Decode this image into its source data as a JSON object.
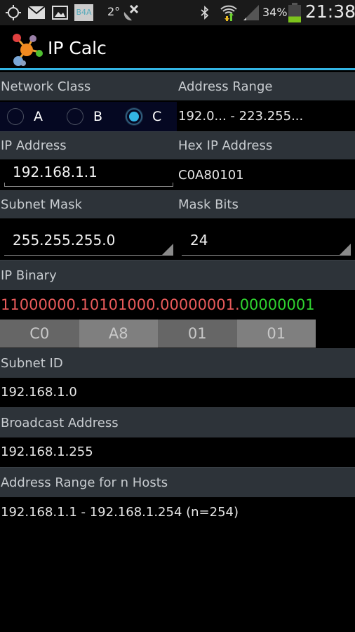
{
  "status_bar": {
    "icons_left": [
      "gps-icon",
      "email-icon",
      "gallery-icon",
      "b4a-icon",
      "weather-icon",
      "satellite-off-icon"
    ],
    "b4a_label": "B4A",
    "temperature": "2°",
    "icons_right": [
      "bluetooth-icon",
      "wifi-icon",
      "signal-icon",
      "battery-icon"
    ],
    "battery": "34%",
    "battery_level": 0.34,
    "time": "21:38"
  },
  "app": {
    "title": "IP Calc",
    "accent_color": "#33b5e5"
  },
  "network_class": {
    "label": "Network Class",
    "options": [
      {
        "label": "A",
        "checked": false
      },
      {
        "label": "B",
        "checked": false
      },
      {
        "label": "C",
        "checked": true
      }
    ]
  },
  "address_range": {
    "label": "Address Range",
    "value": "192.0... - 223.255..."
  },
  "ip_address": {
    "label": "IP Address",
    "value": "192.168.1.1"
  },
  "hex_ip": {
    "label": "Hex IP Address",
    "value": "C0A80101"
  },
  "subnet_mask": {
    "label": "Subnet Mask",
    "value": "255.255.255.0"
  },
  "mask_bits": {
    "label": "Mask Bits",
    "value": "24"
  },
  "ip_binary": {
    "label": "IP Binary",
    "network_part": "11000000.10101000.00000001.",
    "host_part": "00000001",
    "network_color": "#e85a5a",
    "host_color": "#2fd22f",
    "hex_octets": [
      {
        "value": "C0",
        "color": "#666666"
      },
      {
        "value": "A8",
        "color": "#7f7f7f"
      },
      {
        "value": "01",
        "color": "#666666"
      },
      {
        "value": "01",
        "color": "#7f7f7f"
      }
    ]
  },
  "subnet_id": {
    "label": "Subnet ID",
    "value": "192.168.1.0"
  },
  "broadcast": {
    "label": "Broadcast Address",
    "value": "192.168.1.255"
  },
  "host_range": {
    "label": "Address Range for n Hosts",
    "value": "192.168.1.1 - 192.168.1.254 (n=254)"
  }
}
